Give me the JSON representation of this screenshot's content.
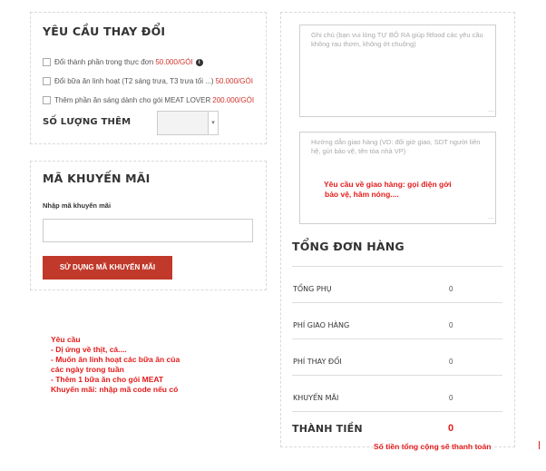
{
  "change_request": {
    "title": "YÊU CẦU THAY ĐỔI",
    "options": [
      {
        "text": "Đổi thành phần trong thực đơn",
        "price": "50.000/GÓI",
        "info_icon": "info-icon"
      },
      {
        "text": "Đổi bữa ăn linh hoạt (T2 sáng trưa, T3 trưa tối ...)",
        "price": "50.000/GÓI"
      },
      {
        "text": "Thêm phần ăn sáng dành cho gói MEAT LOVER",
        "price": "200.000/GÓI"
      }
    ],
    "extra_quantity_label": "SỐ LƯỢNG THÊM",
    "extra_quantity_value": ""
  },
  "promo": {
    "title": "MÃ KHUYẾN MÃI",
    "input_label": "Nhập mã khuyến mãi",
    "input_value": "",
    "button_label": "SỬ DỤNG MÃ KHUYẾN MÃI"
  },
  "notes": {
    "note_placeholder": "Ghi chú (bạn vui lòng TỰ BỎ RA giúp fitfood các yêu cầu không rau thơm, không ớt chuông)",
    "delivery_placeholder": "Hướng dẫn giao hàng (VD: đổi giờ giao, SDT người liên hệ, gửi bảo vệ, tên tòa nhà VP)"
  },
  "order_summary": {
    "title": "TỔNG ĐƠN HÀNG",
    "rows": [
      {
        "label": "TỔNG PHỤ",
        "value": "0"
      },
      {
        "label": "PHÍ GIAO HÀNG",
        "value": "0"
      },
      {
        "label": "PHÍ THAY ĐỔI",
        "value": "0"
      },
      {
        "label": "KHUYẾN MÃI",
        "value": "0"
      }
    ],
    "total_label": "THÀNH TIỀN",
    "total_value": "0"
  },
  "annotations": {
    "delivery_note": [
      "Yêu cầu  về giao hàng: gọi điện gởi",
      "bảo vệ, hâm nóng...."
    ],
    "requirements": [
      "Yêu cầu",
      "- Dị ứng về thịt, cá....",
      "- Muốn ăn linh hoạt các bữa ăn của",
      "các ngày trong tuần",
      "- Thêm 1 bữa ăn cho gói MEAT",
      "Khuyến mãi: nhập mã code nếu có"
    ],
    "total_note": "Số tiền tổng cộng sẽ thanh toán"
  },
  "colors": {
    "accent": "#c0392b",
    "annotation": "#e41b1b",
    "price": "#d0342c"
  }
}
